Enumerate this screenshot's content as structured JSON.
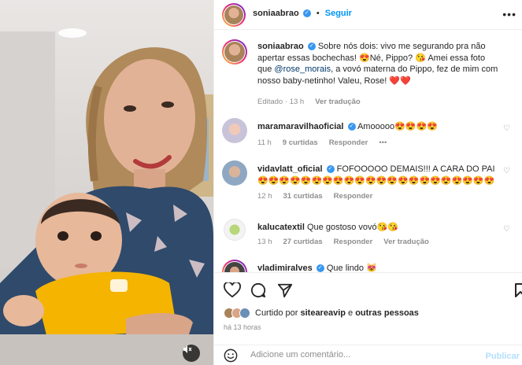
{
  "post": {
    "author": "soniaabrao",
    "follow_label": "Seguir",
    "more_label": "•••"
  },
  "caption": {
    "username": "soniaabrao",
    "text_1": "Sobre nós dois: vivo me segurando pra não apertar essas bochechas! 😍Né, Pippo? 😘 Amei essa foto que ",
    "mention": "@rose_morais",
    "text_2": ", a vovó materna do Pippo, fez de mim com nosso baby-netinho! Valeu, Rose! ❤️❤️",
    "edited": "Editado",
    "age": "13 h",
    "translate": "Ver tradução"
  },
  "comments": [
    {
      "username": "maramaravilhaoficial",
      "verified": true,
      "text": "Amooooo😍😍😍😍",
      "age": "11 h",
      "likes": "9 curtidas",
      "reply": "Responder",
      "more": "•••"
    },
    {
      "username": "vidavlatt_oficial",
      "verified": true,
      "text": "FOFOOOOO DEMAIS!!! A CARA DO PAI 😍😍😍😍😍😍😍😍😍😍😍😍😍😍😍😍😍😍😍😍😍😍",
      "age": "12 h",
      "likes": "31 curtidas",
      "reply": "Responder"
    },
    {
      "username": "kalucatextil",
      "verified": false,
      "text": "Que gostoso vovó😘😘",
      "age": "13 h",
      "likes": "27 curtidas",
      "reply": "Responder",
      "translate": "Ver tradução"
    },
    {
      "username": "vladimiralves",
      "verified": true,
      "text": "Que lindo 😻"
    }
  ],
  "actions": {
    "liked_by_prefix": "Curtido por ",
    "liked_by_user": "siteareavip",
    "liked_by_suffix": " e ",
    "liked_by_others": "outras pessoas",
    "time": "há 13 horas"
  },
  "add_comment": {
    "placeholder": "Adicione um comentário...",
    "publish": "Publicar"
  },
  "colors": {
    "link": "#0095f6",
    "verified": "#3897f0",
    "mention": "#00376b",
    "heart": "#ed4956",
    "muted_text": "#8e8e8e"
  },
  "icons": [
    "heart-icon",
    "comment-icon",
    "share-icon",
    "bookmark-icon",
    "emoji-icon",
    "verified-icon",
    "mute-icon"
  ]
}
